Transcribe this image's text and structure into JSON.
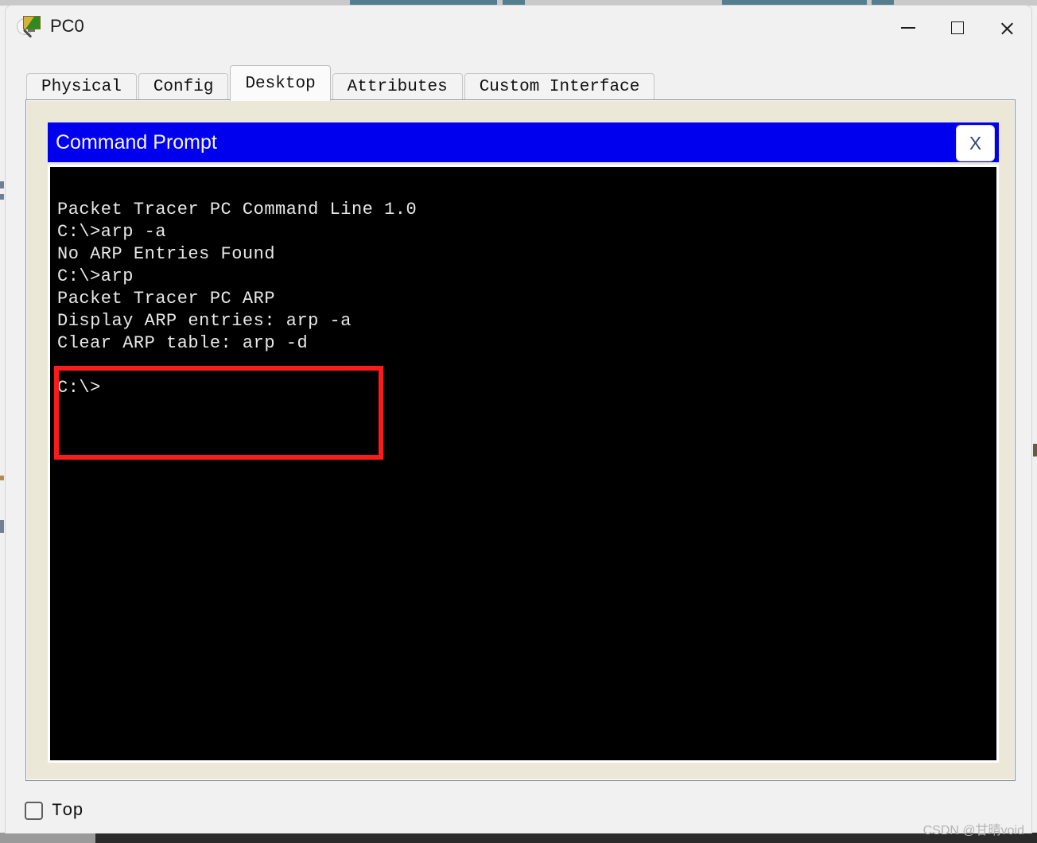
{
  "window": {
    "title": "PC0",
    "icon": "packet-tracer-pc-icon",
    "controls": {
      "minimize": "minimize-icon",
      "maximize": "maximize-icon",
      "close": "close-icon"
    }
  },
  "tabs": [
    {
      "label": "Physical",
      "active": false
    },
    {
      "label": "Config",
      "active": false
    },
    {
      "label": "Desktop",
      "active": true
    },
    {
      "label": "Attributes",
      "active": false
    },
    {
      "label": "Custom Interface",
      "active": false
    }
  ],
  "command_prompt": {
    "title": "Command Prompt",
    "close_label": "X",
    "terminal_lines": [
      "Packet Tracer PC Command Line 1.0",
      "C:\\>arp -a",
      "No ARP Entries Found"
    ],
    "highlighted_lines": [
      "C:\\>arp",
      "Packet Tracer PC ARP",
      "Display ARP entries: arp -a",
      "Clear ARP table: arp -d"
    ],
    "trailing_lines": [
      "",
      "C:\\>"
    ],
    "highlight_color": "#fb1b1b",
    "titlebar_color": "#0000ee",
    "terminal_bg": "#000000",
    "terminal_fg": "#e8e8e8"
  },
  "footer": {
    "top_checkbox_label": "Top",
    "top_checkbox_checked": false
  },
  "watermark": "CSDN @甘晴void"
}
